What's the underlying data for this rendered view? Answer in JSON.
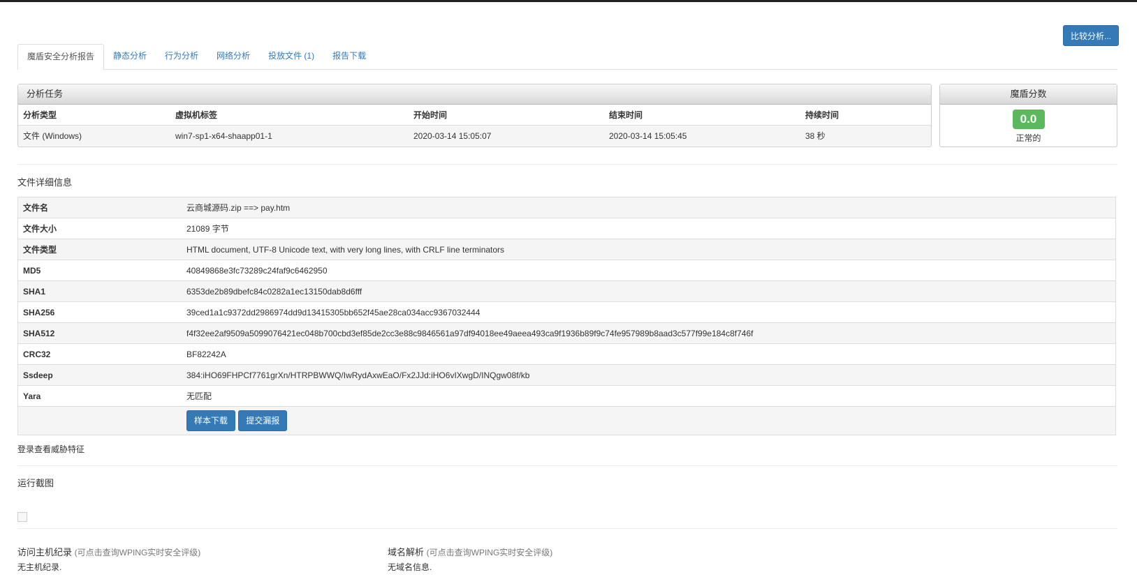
{
  "header": {
    "compare_button": "比较分析..."
  },
  "tabs": [
    {
      "label": "魔盾安全分析报告",
      "active": true
    },
    {
      "label": "静态分析"
    },
    {
      "label": "行为分析"
    },
    {
      "label": "网络分析"
    },
    {
      "label": "投放文件 (1)"
    },
    {
      "label": "报告下载"
    }
  ],
  "task": {
    "title": "分析任务",
    "headers": [
      "分析类型",
      "虚拟机标签",
      "开始时间",
      "结束时间",
      "持续时间"
    ],
    "row": [
      "文件 (Windows)",
      "win7-sp1-x64-shaapp01-1",
      "2020-03-14 15:05:07",
      "2020-03-14 15:05:45",
      "38 秒"
    ]
  },
  "score": {
    "title": "魔盾分数",
    "value": "0.0",
    "status": "正常的",
    "color": "#5cb85c"
  },
  "file_details": {
    "title": "文件详细信息",
    "rows": [
      {
        "key": "文件名",
        "value": "云商城源码.zip ==> pay.htm"
      },
      {
        "key": "文件大小",
        "value": "21089 字节"
      },
      {
        "key": "文件类型",
        "value": "HTML document, UTF-8 Unicode text, with very long lines, with CRLF line terminators"
      },
      {
        "key": "MD5",
        "value": "40849868e3fc73289c24faf9c6462950"
      },
      {
        "key": "SHA1",
        "value": "6353de2b89dbefc84c0282a1ec13150dab8d6fff"
      },
      {
        "key": "SHA256",
        "value": "39ced1a1c9372dd2986974dd9d13415305bb652f45ae28ca034acc9367032444"
      },
      {
        "key": "SHA512",
        "value": "f4f32ee2af9509a5099076421ec048b700cbd3ef85de2cc3e88c9846561a97df94018ee49aeea493ca9f1936b89f9c74fe957989b8aad3c577f99e184c8f746f"
      },
      {
        "key": "CRC32",
        "value": "BF82242A"
      },
      {
        "key": "Ssdeep",
        "value": "384:iHO69FHPCf7761grXn/HTRPBWWQ/IwRydAxwEaO/Fx2JJd:iHO6vIXwgD/INQgw08f/kb"
      },
      {
        "key": "Yara",
        "value": "无匹配"
      }
    ],
    "download_button": "样本下载",
    "report_button": "提交漏报"
  },
  "login_text": "登录查看威胁特征",
  "screenshots_title": "运行截图",
  "hosts": {
    "title": "访问主机纪录",
    "hint": "(可点击查询WPING实时安全评级)",
    "empty": "无主机纪录."
  },
  "dns": {
    "title": "域名解析",
    "hint": "(可点击查询WPING实时安全评级)",
    "empty": "无域名信息."
  }
}
